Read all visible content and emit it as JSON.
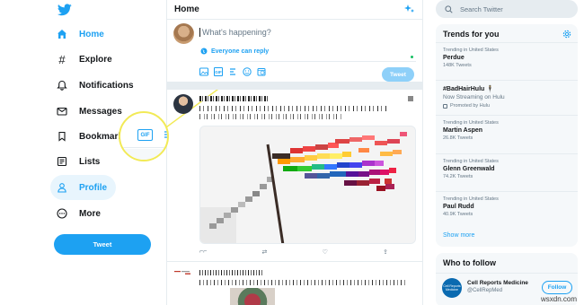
{
  "colors": {
    "accent": "#1da1f2",
    "text": "#14171a",
    "muted": "#657786",
    "border": "#e6ecf0",
    "highlight": "#f2ea56"
  },
  "sidebar": {
    "logo_icon": "twitter-bird-icon",
    "items": [
      {
        "label": "Home",
        "icon": "home-icon",
        "active_color": true
      },
      {
        "label": "Explore",
        "icon": "hashtag-icon"
      },
      {
        "label": "Notifications",
        "icon": "bell-icon"
      },
      {
        "label": "Messages",
        "icon": "envelope-icon"
      },
      {
        "label": "Bookmarks",
        "icon": "bookmark-icon"
      },
      {
        "label": "Lists",
        "icon": "list-icon"
      },
      {
        "label": "Profile",
        "icon": "person-icon",
        "selected": true
      },
      {
        "label": "More",
        "icon": "more-circle-icon"
      }
    ],
    "tweet_button": "Tweet"
  },
  "magnifier": {
    "gif_label": "GIF"
  },
  "main": {
    "title": "Home",
    "compose": {
      "placeholder": "What's happening?",
      "reply_setting": "Everyone can reply",
      "gif_label": "GIF",
      "tweet_button": "Tweet"
    }
  },
  "right": {
    "search_placeholder": "Search Twitter",
    "trends_title": "Trends for you",
    "trends": [
      {
        "context": "Trending in United States",
        "name": "Perdue",
        "count": "148K Tweets"
      },
      {
        "name": "#BadHairHulu",
        "subtitle": "Now Streaming on Hulu",
        "promoted": "Promoted by Hulu"
      },
      {
        "context": "Trending in United States",
        "name": "Martin Aspen",
        "count": "26.8K Tweets"
      },
      {
        "context": "Trending in United States",
        "name": "Glenn Greenwald",
        "count": "74.2K Tweets"
      },
      {
        "context": "Trending in United States",
        "name": "Paul Rudd",
        "count": "40.9K Tweets"
      }
    ],
    "show_more": "Show more",
    "who_title": "Who to follow",
    "who": {
      "name": "Cell Reports Medicine",
      "handle": "@CellRepMed",
      "follow": "Follow",
      "avatar_text": "Cell Reports Medicine"
    }
  },
  "watermark": "wsxdn.com"
}
